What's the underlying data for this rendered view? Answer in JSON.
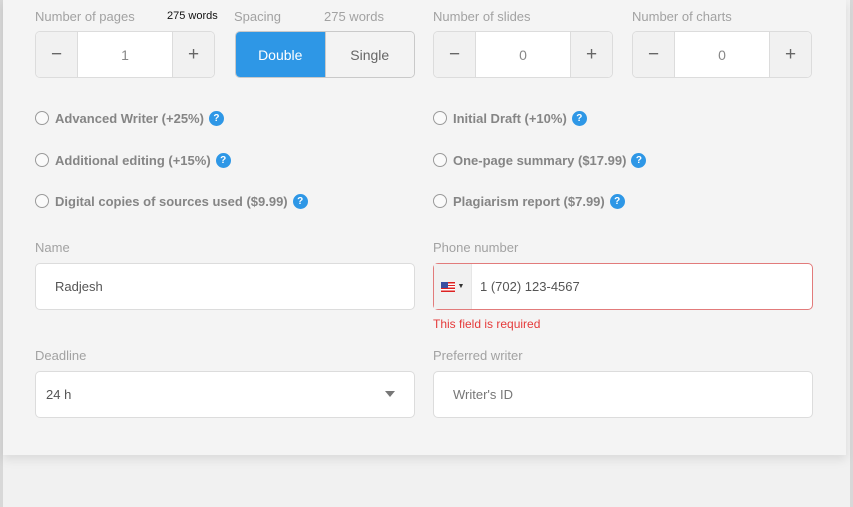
{
  "pages": {
    "label": "Number of pages",
    "words": "275 words",
    "value": "1",
    "minus": "−",
    "plus": "+"
  },
  "spacing": {
    "label": "Spacing",
    "words": "275 words",
    "options": [
      "Double",
      "Single"
    ],
    "selected": "Double"
  },
  "slides": {
    "label": "Number of slides",
    "value": "0",
    "minus": "−",
    "plus": "+"
  },
  "charts": {
    "label": "Number of charts",
    "value": "0",
    "minus": "−",
    "plus": "+"
  },
  "addons": {
    "help_glyph": "?",
    "items": [
      {
        "label": "Advanced Writer (+25%)"
      },
      {
        "label": "Initial Draft (+10%)"
      },
      {
        "label": "Additional editing (+15%)"
      },
      {
        "label": "One-page summary ($17.99)"
      },
      {
        "label": "Digital copies of sources used ($9.99)"
      },
      {
        "label": "Plagiarism report ($7.99)"
      }
    ]
  },
  "name": {
    "label": "Name",
    "value": "Radjesh"
  },
  "phone": {
    "label": "Phone number",
    "value": "1 (702) 123-4567",
    "country_flag": "us-flag-icon",
    "caret": "▼",
    "error": "This field is required"
  },
  "deadline": {
    "label": "Deadline",
    "value": "24 h"
  },
  "writer": {
    "label": "Preferred writer",
    "placeholder": "Writer's ID"
  },
  "colors": {
    "accent": "#2e97e6",
    "error": "#e53a3a",
    "error_border": "#e27b7b"
  }
}
